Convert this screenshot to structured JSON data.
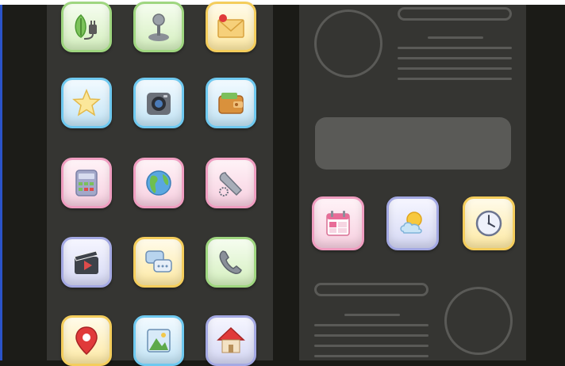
{
  "colors": {
    "panel_background": "#353532",
    "outer_background": "#1b1b17",
    "wireframe_gray": "#5a5a57",
    "accent_left_edge": "#2a53c9"
  },
  "left_screen": {
    "icons": [
      {
        "name": "eco-plug-icon",
        "tint": "green"
      },
      {
        "name": "joystick-icon",
        "tint": "green"
      },
      {
        "name": "mail-icon",
        "tint": "green"
      },
      {
        "name": "star-icon",
        "tint": "blue"
      },
      {
        "name": "camera-icon",
        "tint": "blue"
      },
      {
        "name": "wallet-icon",
        "tint": "blue"
      },
      {
        "name": "calculator-icon",
        "tint": "pink"
      },
      {
        "name": "globe-icon",
        "tint": "pink"
      },
      {
        "name": "settings-wrench-icon",
        "tint": "pink"
      },
      {
        "name": "video-icon",
        "tint": "lavender"
      },
      {
        "name": "chat-icon",
        "tint": "yellow"
      },
      {
        "name": "phone-icon",
        "tint": "green"
      },
      {
        "name": "location-pin-icon",
        "tint": "yellow"
      },
      {
        "name": "gallery-icon",
        "tint": "blue"
      },
      {
        "name": "home-icon",
        "tint": "lavender"
      }
    ]
  },
  "right_screen": {
    "icons": [
      {
        "name": "calendar-icon",
        "tint": "pink"
      },
      {
        "name": "weather-icon",
        "tint": "lavender"
      },
      {
        "name": "clock-icon",
        "tint": "yellow"
      }
    ]
  }
}
